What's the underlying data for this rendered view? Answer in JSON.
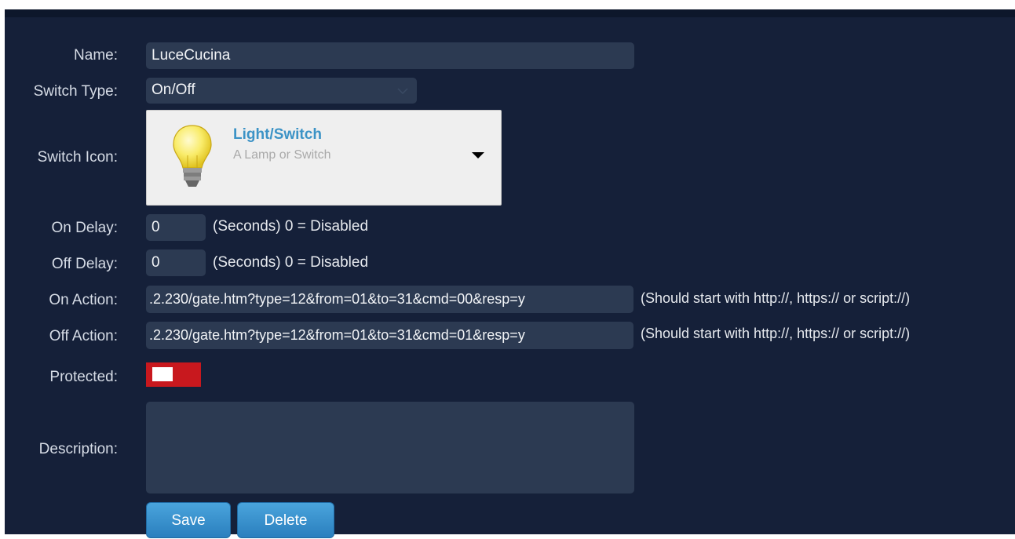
{
  "form": {
    "name_label": "Name:",
    "name_value": "LuceCucina",
    "switch_type_label": "Switch Type:",
    "switch_type_value": "On/Off",
    "switch_icon_label": "Switch Icon:",
    "switch_icon_title": "Light/Switch",
    "switch_icon_subtitle": "A Lamp or Switch",
    "on_delay_label": "On Delay:",
    "on_delay_value": "0",
    "off_delay_label": "Off Delay:",
    "off_delay_value": "0",
    "delay_hint": "(Seconds) 0 = Disabled",
    "on_action_label": "On Action:",
    "on_action_value": ".2.230/gate.htm?type=12&from=01&to=31&cmd=00&resp=y",
    "off_action_label": "Off Action:",
    "off_action_value": ".2.230/gate.htm?type=12&from=01&to=31&cmd=01&resp=y",
    "action_hint": "(Should start with http://, https:// or script://)",
    "protected_label": "Protected:",
    "protected_on": false,
    "description_label": "Description:",
    "description_value": ""
  },
  "buttons": {
    "save_label": "Save",
    "delete_label": "Delete"
  },
  "icons": {
    "switch_icon": "light-bulb-icon",
    "dropdown_arrow": "caret-down-icon",
    "select_chevron": "chevron-down-icon"
  },
  "colors": {
    "background": "#152039",
    "field": "#2c3a52",
    "accent": "#3c93c6",
    "toggle": "#c8181e",
    "button": "#2a7fbe"
  }
}
